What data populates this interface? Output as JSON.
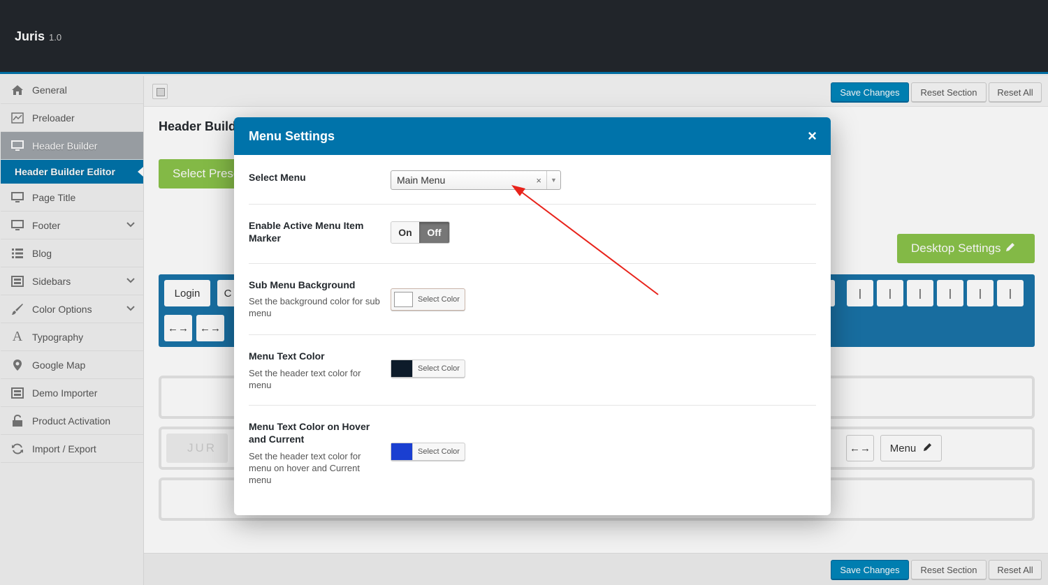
{
  "app": {
    "name": "Juris",
    "version": "1.0"
  },
  "sidebar": {
    "items": [
      {
        "label": "General",
        "icon": "home-icon"
      },
      {
        "label": "Preloader",
        "icon": "chart-icon"
      },
      {
        "label": "Header Builder",
        "icon": "monitor-icon",
        "active": true
      },
      {
        "label": "Page Title",
        "icon": "monitor-icon"
      },
      {
        "label": "Footer",
        "icon": "monitor-icon"
      },
      {
        "label": "Blog",
        "icon": "list-icon"
      },
      {
        "label": "Sidebars",
        "icon": "layout-icon"
      },
      {
        "label": "Color Options",
        "icon": "brush-icon"
      },
      {
        "label": "Typography",
        "icon": "typography-icon"
      },
      {
        "label": "Google Map",
        "icon": "location-pin-icon"
      },
      {
        "label": "Demo Importer",
        "icon": "layout-icon"
      },
      {
        "label": "Product Activation",
        "icon": "unlock-icon"
      },
      {
        "label": "Import / Export",
        "icon": "refresh-icon"
      }
    ],
    "sub_item": "Header Builder Editor"
  },
  "toolbar": {
    "save": "Save Changes",
    "reset_section": "Reset Section",
    "reset_all": "Reset All"
  },
  "main": {
    "section_title": "Header Builder",
    "select_preset": "Select Preset",
    "desktop_settings": "Desktop Settings",
    "chips": {
      "login": "Login",
      "c": "C",
      "bar": "|",
      "swap": "←→",
      "menu": "Menu",
      "logo_text": "JUR"
    }
  },
  "modal": {
    "title": "Menu Settings",
    "close": "×",
    "select_menu": {
      "label": "Select Menu",
      "value": "Main Menu",
      "clear": "×",
      "arrow": "▼"
    },
    "active_marker": {
      "label": "Enable Active Menu Item Marker",
      "on": "On",
      "off": "Off",
      "state": "off"
    },
    "sub_menu_bg": {
      "label": "Sub Menu Background",
      "desc": "Set the background color for sub menu",
      "button": "Select Color",
      "color": "#ffffff"
    },
    "menu_text_color": {
      "label": "Menu Text Color",
      "desc": "Set the header text color for menu",
      "button": "Select Color",
      "color": "#0d1b2a"
    },
    "menu_hover_color": {
      "label": "Menu Text Color on Hover and Current",
      "desc": "Set the header text color for menu on hover and Current menu",
      "button": "Select Color",
      "color": "#1a3fd1"
    }
  },
  "colors": {
    "accent": "#0073aa",
    "green": "#8bc34a",
    "annotation": "#e8231b"
  }
}
